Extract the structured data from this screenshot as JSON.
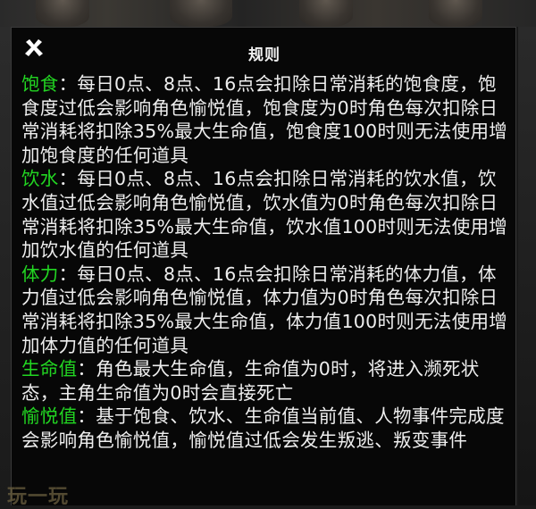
{
  "dialog": {
    "title": "规则",
    "close_icon": "close-icon"
  },
  "rules": [
    {
      "term": "饱食",
      "text": "：每日0点、8点、16点会扣除日常消耗的饱食度，饱食度过低会影响角色愉悦值，饱食度为0时角色每次扣除日常消耗将扣除35%最大生命值，饱食度100时则无法使用增加饱食度的任何道具"
    },
    {
      "term": "饮水",
      "text": "：每日0点、8点、16点会扣除日常消耗的饮水值，饮水值过低会影响角色愉悦值，饮水值为0时角色每次扣除日常消耗将扣除35%最大生命值，饮水值100时则无法使用增加饮水值的任何道具"
    },
    {
      "term": "体力",
      "text": "：每日0点、8点、16点会扣除日常消耗的体力值，体力值过低会影响角色愉悦值，体力值为0时角色每次扣除日常消耗将扣除35%最大生命值，体力值100时则无法使用增加体力值的任何道具"
    },
    {
      "term": "生命值",
      "text": "：角色最大生命值，生命值为0时，将进入濒死状态，主角生命值为0时会直接死亡"
    },
    {
      "term": "愉悦值",
      "text": "：基于饱食、饮水、生命值当前值、人物事件完成度会影响角色愉悦值，愉悦值过低会发生叛逃、叛变事件"
    }
  ],
  "watermark": "玩一玩",
  "colors": {
    "term": "#22d622",
    "text": "#eeeeee",
    "panel_bg": "#070707"
  }
}
